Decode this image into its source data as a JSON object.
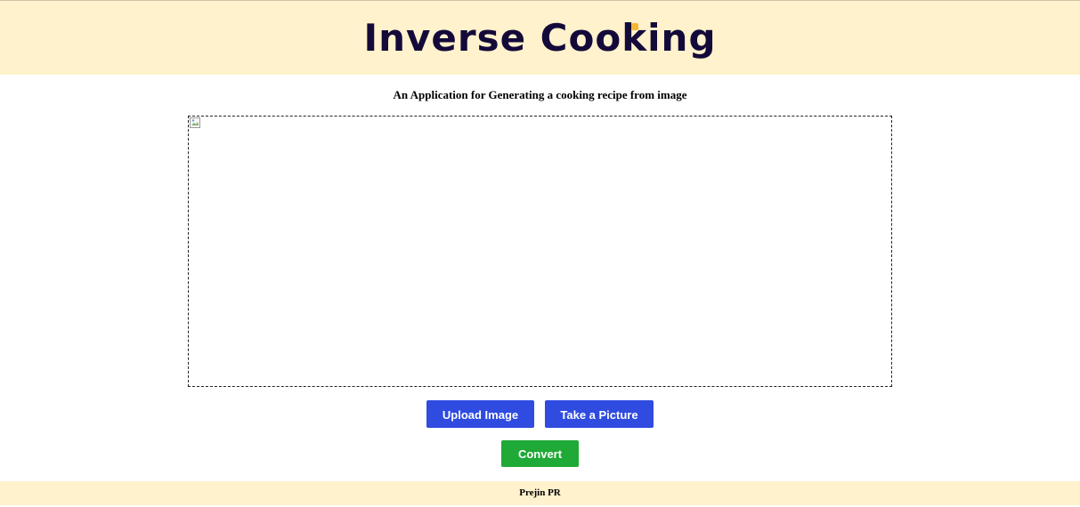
{
  "header": {
    "title": "Inverse Cooking",
    "background_color": "#fff2cc",
    "title_color": "#140a3a",
    "accent_color": "#f5b731"
  },
  "main": {
    "subtitle": "An Application for Generating a cooking recipe from image",
    "image_preview": {
      "icon": "broken-image-icon"
    }
  },
  "actions": {
    "upload_label": "Upload Image",
    "take_picture_label": "Take a Picture",
    "convert_label": "Convert",
    "primary_color": "#2f4be0",
    "convert_color": "#1fa936"
  },
  "footer": {
    "text": "Prejin PR"
  }
}
